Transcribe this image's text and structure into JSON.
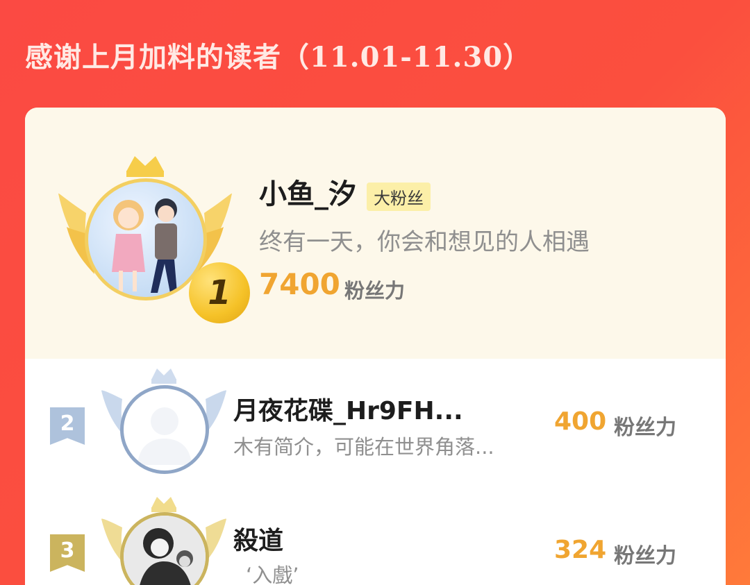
{
  "header": {
    "title": "感谢上月加料的读者",
    "range": "（11.01-11.30）"
  },
  "colors": {
    "accent": "#f0a531",
    "gold": "#f3cf61",
    "silver": "#8fa6c7",
    "bronze": "#cbb45e",
    "bg_red": "#fb4a43"
  },
  "rank1": {
    "rank": "1",
    "name": "小鱼_汐",
    "badge": "大粉丝",
    "bio": "终有一天，你会和想见的人相遇",
    "score": "7400",
    "unit": "粉丝力",
    "icon": "gold-crown-wings-icon"
  },
  "rank2": {
    "rank": "2",
    "name": "月夜花碟_Hr9FH...",
    "bio": "木有简介，可能在世界角落...",
    "score": "400",
    "unit": "粉丝力",
    "icon": "silver-crown-wings-icon"
  },
  "rank3": {
    "rank": "3",
    "name": "殺道",
    "bio": "‘入戲’",
    "score": "324",
    "unit": "粉丝力",
    "icon": "bronze-crown-wings-icon"
  }
}
